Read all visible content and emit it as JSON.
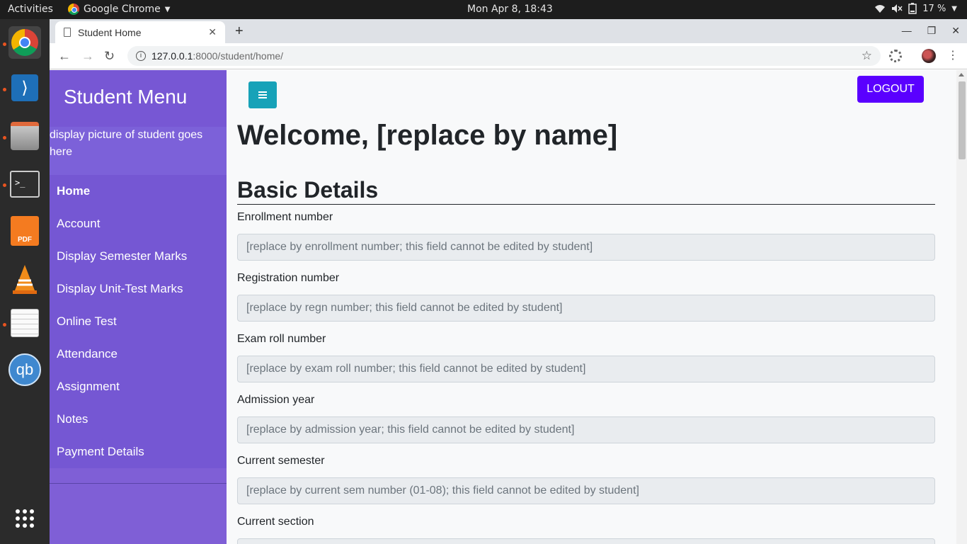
{
  "os": {
    "activities": "Activities",
    "app_name": "Google Chrome",
    "clock": "Mon Apr  8, 18:43",
    "battery": "17 %"
  },
  "browser": {
    "tab_title": "Student Home",
    "url_host": "127.0.0.1",
    "url_path": ":8000/student/home/"
  },
  "sidebar": {
    "title": "Student Menu",
    "profile_alt": "display picture of student goes here",
    "items": [
      {
        "label": "Home"
      },
      {
        "label": "Account"
      },
      {
        "label": "Display Semester Marks"
      },
      {
        "label": "Display Unit-Test Marks"
      },
      {
        "label": "Online Test"
      },
      {
        "label": "Attendance"
      },
      {
        "label": "Assignment"
      },
      {
        "label": "Notes"
      },
      {
        "label": "Payment Details"
      }
    ]
  },
  "header": {
    "logout_label": "LOGOUT",
    "welcome": "Welcome, [replace by name]"
  },
  "basic_details": {
    "title": "Basic Details",
    "fields": [
      {
        "label": "Enrollment number",
        "value": "[replace by enrollment number; this field cannot be edited by student]"
      },
      {
        "label": "Registration number",
        "value": "[replace by regn number; this field cannot be edited by student]"
      },
      {
        "label": "Exam roll number",
        "value": "[replace by exam roll number; this field cannot be edited by student]"
      },
      {
        "label": "Admission year",
        "value": "[replace by admission year; this field cannot be edited by student]"
      },
      {
        "label": "Current semester",
        "value": "[replace by current sem number (01-08); this field cannot be edited by student]"
      },
      {
        "label": "Current section",
        "value": ""
      }
    ]
  },
  "colors": {
    "sidebar": "#7557d3",
    "logout": "#5a00ff",
    "toggle": "#17a2b8"
  }
}
